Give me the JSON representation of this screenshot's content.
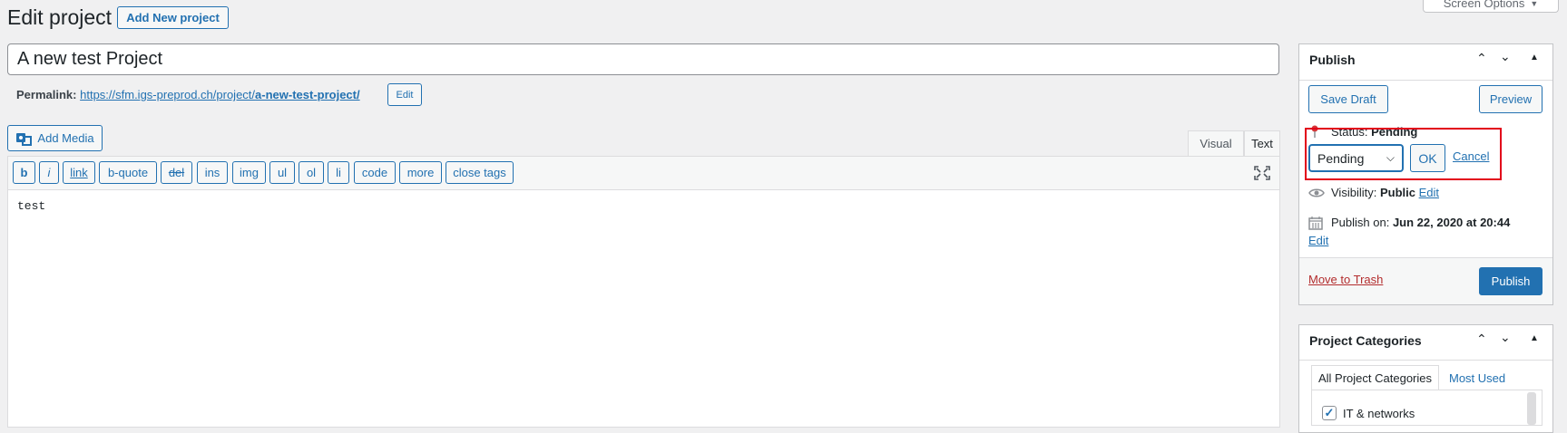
{
  "header": {
    "title": "Edit project",
    "add_new_label": "Add New project",
    "screen_options_label": "Screen Options"
  },
  "post": {
    "title_value": "A new test Project",
    "permalink_label": "Permalink:",
    "permalink_base": "https://sfm.igs-preprod.ch/project/",
    "permalink_slug": "a-new-test-project/",
    "permalink_edit_label": "Edit"
  },
  "editor": {
    "add_media_label": "Add Media",
    "tab_visual": "Visual",
    "tab_text": "Text",
    "content": "test",
    "quicktags": [
      "b",
      "i",
      "link",
      "b-quote",
      "del",
      "ins",
      "img",
      "ul",
      "ol",
      "li",
      "code",
      "more",
      "close tags"
    ]
  },
  "publish": {
    "title": "Publish",
    "save_draft_label": "Save Draft",
    "preview_label": "Preview",
    "status_label": "Status:",
    "status_value": "Pending",
    "status_select_value": "Pending",
    "ok_label": "OK",
    "cancel_label": "Cancel",
    "visibility_label": "Visibility:",
    "visibility_value": "Public",
    "visibility_edit": "Edit",
    "publish_on_label": "Publish on:",
    "publish_on_value": "Jun 22, 2020 at 20:44",
    "publish_on_edit": "Edit",
    "trash_label": "Move to Trash",
    "publish_button_label": "Publish"
  },
  "categories": {
    "title": "Project Categories",
    "tab_all": "All Project Categories",
    "tab_most_used": "Most Used",
    "items": [
      {
        "label": "IT & networks",
        "checked": true
      }
    ]
  },
  "colors": {
    "accent": "#2271b1",
    "highlight_box": "#e2001a",
    "trash": "#b32d2e"
  }
}
